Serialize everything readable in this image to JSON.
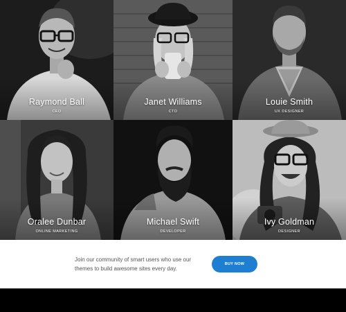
{
  "team": [
    {
      "name": "Raymond Ball",
      "role": "CEO"
    },
    {
      "name": "Janet Williams",
      "role": "CTO"
    },
    {
      "name": "Louie Smith",
      "role": "UX DESIGNER"
    },
    {
      "name": "Oralee Dunbar",
      "role": "ONLINE MARKETING"
    },
    {
      "name": "Michael Swift",
      "role": "DEVELOPER"
    },
    {
      "name": "Ivy Goldman",
      "role": "DESIGNER"
    }
  ],
  "cta": {
    "text": "Join our community of smart users who use our themes to build awesome sites every day.",
    "button_label": "BUY NOW"
  },
  "colors": {
    "accent": "#1e7fd2",
    "cta_background": "#ffffff",
    "page_background": "#000000"
  }
}
